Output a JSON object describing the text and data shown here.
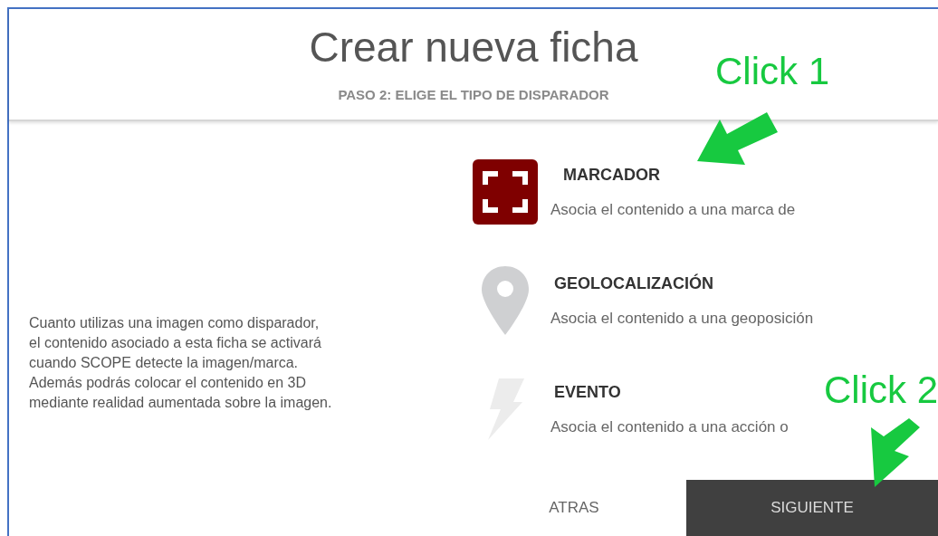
{
  "header": {
    "title": "Crear nueva ficha",
    "subtitle": "PASO 2: ELIGE EL TIPO DE DISPARADOR"
  },
  "description": "Cuanto utilizas una imagen como disparador, el contenido asociado a esta ficha se activará cuando SCOPE detecte la imagen/marca.  Además podrás colocar el contenido en 3D mediante realidad aumentada sobre la imagen.",
  "options": [
    {
      "kind": "marker",
      "title": "MARCADOR",
      "description": "Asocia el contenido a una marca de",
      "selected": true
    },
    {
      "kind": "location",
      "title": "GEOLOCALIZACIÓN",
      "description": "Asocia el contenido a una geoposición",
      "selected": false
    },
    {
      "kind": "event",
      "title": "EVENTO",
      "description": "Asocia el contenido a una acción o",
      "selected": false
    }
  ],
  "buttons": [
    {
      "kind": "back",
      "label": "ATRAS"
    },
    {
      "kind": "next",
      "label": "SIGUIENTE"
    }
  ],
  "annotations": [
    "Click 1",
    "Click 2"
  ]
}
